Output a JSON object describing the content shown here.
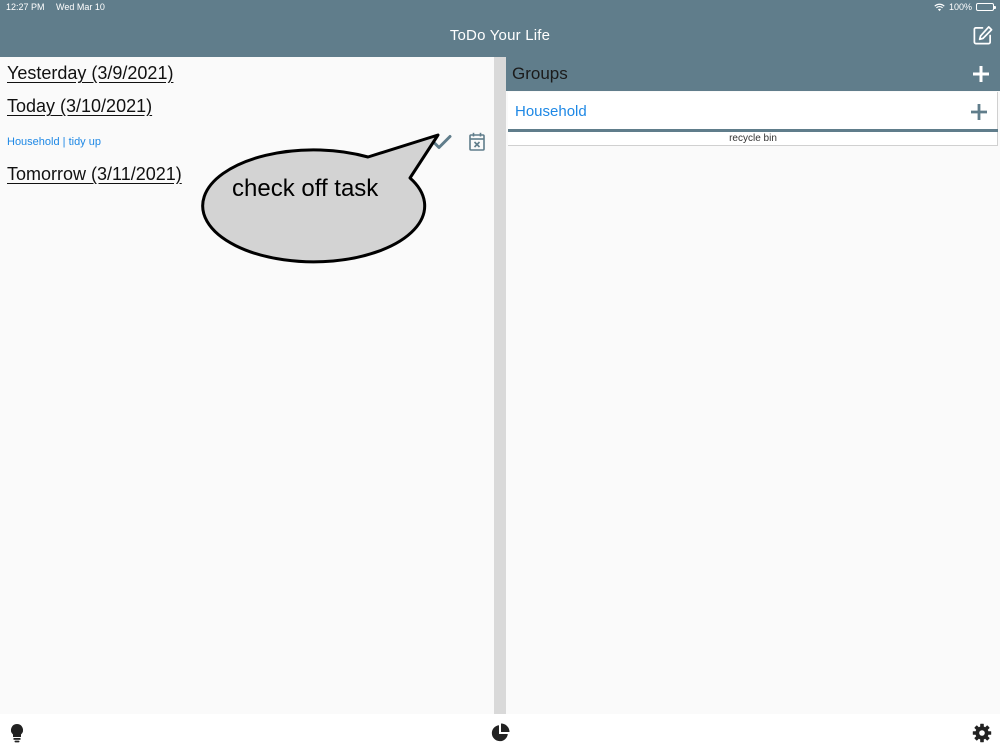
{
  "status_bar": {
    "time": "12:27 PM",
    "date": "Wed Mar 10",
    "battery": "100%",
    "battery_level": 1.0,
    "wifi_icon": "wifi-icon"
  },
  "nav": {
    "title": "ToDo Your Life",
    "compose_icon": "compose-icon"
  },
  "schedule": {
    "yesterday": "Yesterday (3/9/2021)",
    "today": "Today (3/10/2021)",
    "tomorrow": "Tomorrow (3/11/2021)",
    "today_tasks": [
      {
        "label": "Household | tidy up",
        "complete_icon": "check-icon",
        "postpone_icon": "calendar-x-icon"
      }
    ]
  },
  "groups": {
    "title": "Groups",
    "add_icon": "plus-icon",
    "items": [
      {
        "name": "Household",
        "add_icon": "plus-icon"
      }
    ],
    "recycle_bin": "recycle bin"
  },
  "bottom_bar": {
    "left_icon": "lightbulb-icon",
    "center_icon": "pie-chart-icon",
    "right_icon": "gear-icon"
  },
  "callout": {
    "text": "check off task"
  },
  "colors": {
    "primary": "#607d8b",
    "link": "#1e88e5",
    "background": "#fafafa",
    "divider": "#d9d9d9",
    "callout_fill": "#d3d3d3"
  }
}
